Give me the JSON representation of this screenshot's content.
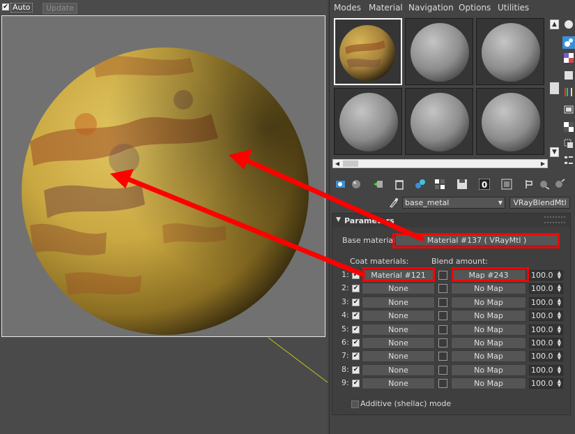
{
  "render_window": {
    "auto_label": "Auto",
    "auto_checked": true,
    "update_label": "Update"
  },
  "menu": [
    "Modes",
    "Material",
    "Navigation",
    "Options",
    "Utilities"
  ],
  "toolbar_icons": [
    "get-material-icon",
    "put-to-scene-icon",
    "assign-material-icon",
    "delete-icon",
    "make-unique-icon",
    "put-to-library-icon",
    "material-id-icon",
    "show-map-icon",
    "show-end-result-icon",
    "go-to-parent-icon",
    "go-forward-sibling-icon",
    "pick-from-object-icon",
    "options-icon"
  ],
  "material_selector": {
    "name": "base_metal",
    "type": "VRayBlendMtl"
  },
  "parameters": {
    "title": "Parameters",
    "base_material_label": "Base material:",
    "base_material": "Material #137  ( VRayMtl )",
    "coat_header": "Coat materials:",
    "blend_header": "Blend amount:",
    "rows": [
      {
        "num": "1:",
        "coat": "Material #121",
        "blend": "Map #243",
        "amount": "100.0"
      },
      {
        "num": "2:",
        "coat": "None",
        "blend": "No Map",
        "amount": "100.0"
      },
      {
        "num": "3:",
        "coat": "None",
        "blend": "No Map",
        "amount": "100.0"
      },
      {
        "num": "4:",
        "coat": "None",
        "blend": "No Map",
        "amount": "100.0"
      },
      {
        "num": "5:",
        "coat": "None",
        "blend": "No Map",
        "amount": "100.0"
      },
      {
        "num": "6:",
        "coat": "None",
        "blend": "No Map",
        "amount": "100.0"
      },
      {
        "num": "7:",
        "coat": "None",
        "blend": "No Map",
        "amount": "100.0"
      },
      {
        "num": "8:",
        "coat": "None",
        "blend": "No Map",
        "amount": "100.0"
      },
      {
        "num": "9:",
        "coat": "None",
        "blend": "No Map",
        "amount": "100.0"
      }
    ],
    "shellac_label": "Additive (shellac) mode"
  },
  "colors": {
    "highlight": "#ff0000",
    "panel_bg": "#444444",
    "button_bg": "#555555",
    "render_bg": "#717171",
    "sphere_base": "#c7a640",
    "rust": "#9b4c24"
  }
}
